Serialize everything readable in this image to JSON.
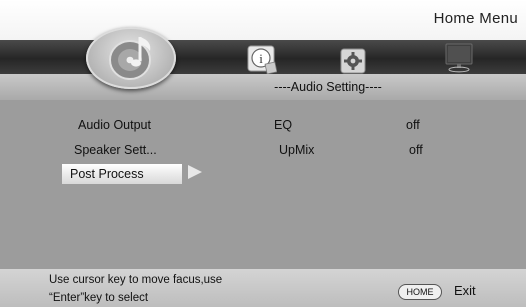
{
  "header": {
    "title": "Home  Menu"
  },
  "tabs": [
    {
      "icon": "info-icon",
      "glyph": "i"
    },
    {
      "icon": "gear-icon"
    },
    {
      "icon": "tv-icon"
    }
  ],
  "logo": {
    "icon": "disc-music-icon"
  },
  "section_title": "----Audio Setting----",
  "menu": {
    "items": [
      {
        "label": "Audio Output",
        "option": "EQ",
        "value": "off"
      },
      {
        "label": "Speaker Sett...",
        "option": "UpMix",
        "value": "off"
      },
      {
        "label": "Post  Process",
        "selected": true
      }
    ]
  },
  "footer": {
    "help_line1": "Use cursor key to move facus,use",
    "help_line2": "“Enter”key to select",
    "home_key": "HOME",
    "exit_label": "Exit"
  }
}
